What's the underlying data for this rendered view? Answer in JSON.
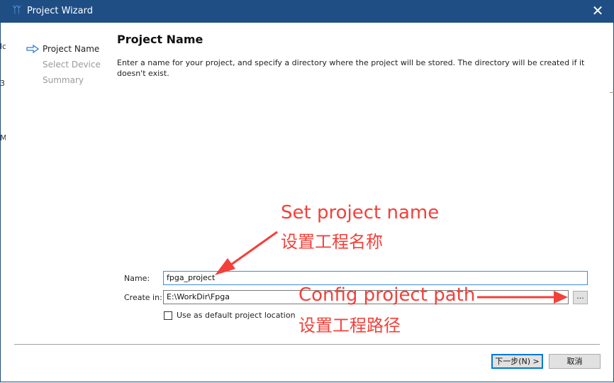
{
  "window": {
    "title": "Project Wizard",
    "close_glyph": "✕",
    "app_icon": "ᛉᛉ"
  },
  "background_fragments": [
    "lc",
    "3",
    "Ma"
  ],
  "steps": [
    {
      "label": "Project Name",
      "current": true
    },
    {
      "label": "Select Device",
      "current": false
    },
    {
      "label": "Summary",
      "current": false
    }
  ],
  "page": {
    "heading": "Project Name",
    "description": "Enter a name for your project, and specify a directory where the project will be stored. The directory will be created if it doesn't exist."
  },
  "form": {
    "name_label": "Name:",
    "name_value": "fpga_project",
    "create_in_label": "Create in:",
    "create_in_value": "E:\\WorkDir\\Fpga",
    "browse_label": "...",
    "default_location_label": "Use as default project location",
    "default_location_checked": false
  },
  "buttons": {
    "next": "下一步(N) >",
    "cancel": "取消"
  },
  "annotations": {
    "name_en": "Set project name",
    "name_cn": "设置工程名称",
    "path_en": "Config project path",
    "path_cn": "设置工程路径",
    "color": "#f3403a"
  },
  "colors": {
    "titlebar": "#1f4e85",
    "focus": "#3d8fd6",
    "default_button_border": "#0078d7",
    "step_arrow": "#2f7fd6"
  }
}
